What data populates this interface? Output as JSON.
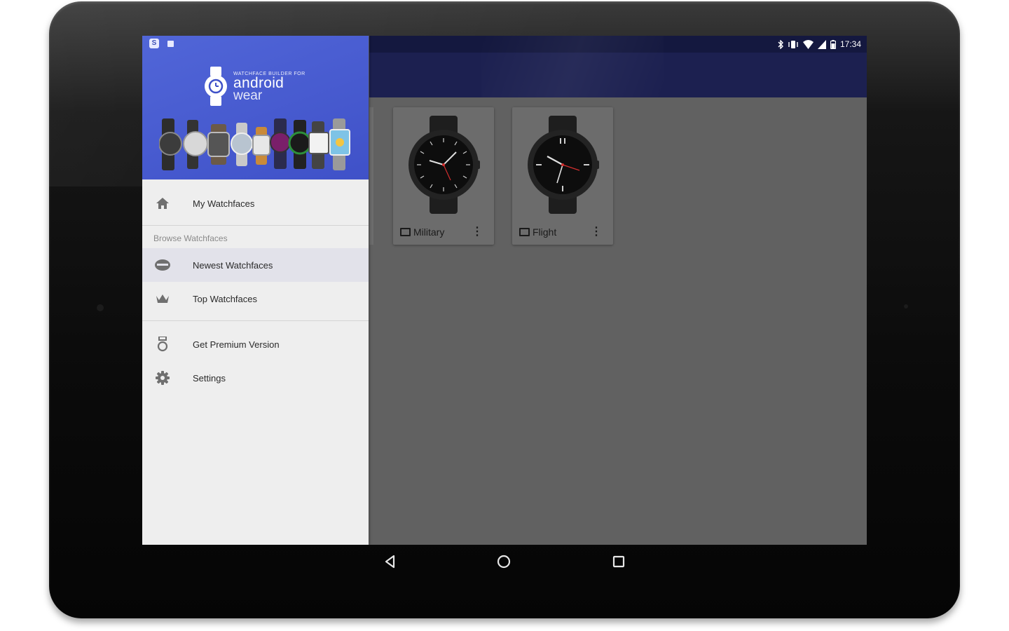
{
  "status_bar": {
    "time": "17:34",
    "icons": [
      "bluetooth-icon",
      "vibrate-icon",
      "wifi-icon",
      "signal-icon",
      "battery-icon"
    ]
  },
  "drawer": {
    "header": {
      "logo_line1": "WATCHFACE BUILDER FOR",
      "logo_line2": "android",
      "logo_line3": "wear"
    },
    "items": [
      {
        "label": "My Watchfaces",
        "icon": "home-icon"
      },
      {
        "label": "Newest Watchfaces",
        "icon": "new-badge-icon",
        "active": true
      },
      {
        "label": "Top Watchfaces",
        "icon": "crown-icon"
      },
      {
        "label": "Get Premium Version",
        "icon": "medal-icon"
      },
      {
        "label": "Settings",
        "icon": "gear-icon"
      }
    ],
    "section_header": "Browse Watchfaces"
  },
  "cards": [
    {
      "title": "Military",
      "menu": "⋮"
    },
    {
      "title": "Flight",
      "menu": "⋮"
    }
  ],
  "colors": {
    "drawer_header": "#4a5dd3",
    "appbar": "#1c2050",
    "scrim": "#616161"
  }
}
